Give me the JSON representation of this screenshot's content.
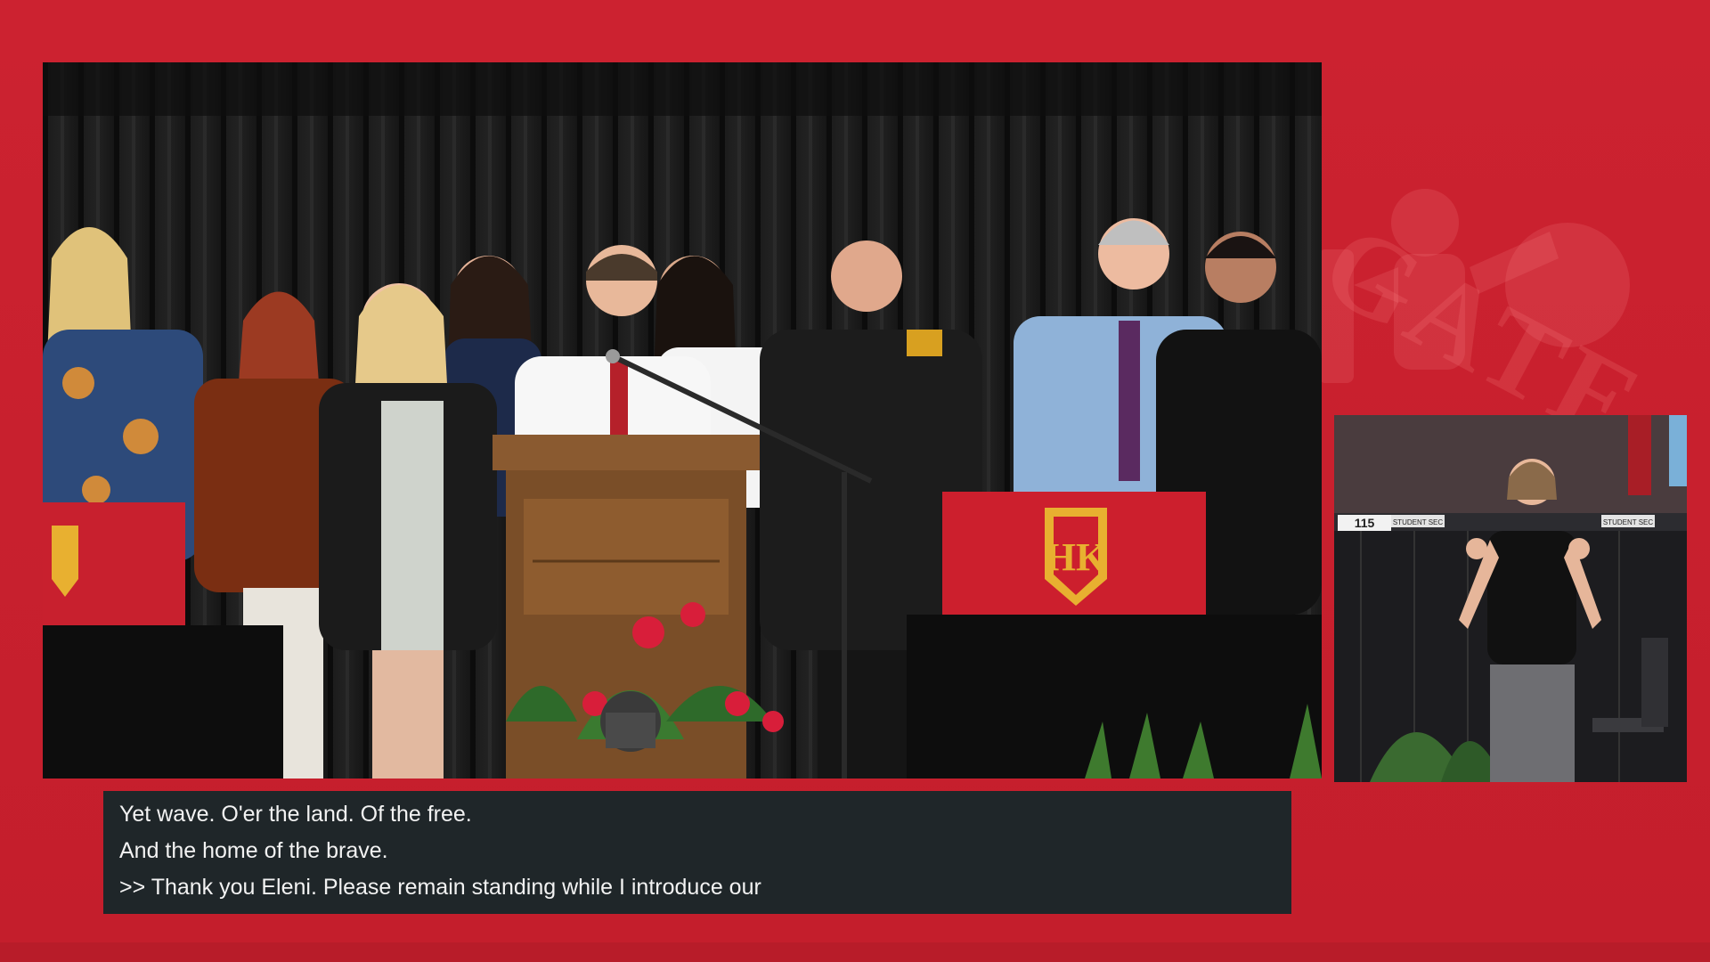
{
  "stream": {
    "brand_watermark": "HELLGATE",
    "accent_color": "#c8202e",
    "caption_bg_color": "#1f2629"
  },
  "main_video": {
    "podium_emblem": "HK",
    "banner_emblem_left": "HK",
    "banner_emblem_right": "HK"
  },
  "interpreter_video": {
    "section_sign_number": "115",
    "section_sign_left": "STUDENT SEC",
    "section_sign_right": "STUDENT SEC"
  },
  "captions": {
    "lines": [
      "Yet wave. O'er the land. Of the free.",
      "And the home of the brave.",
      ">> Thank you Eleni. Please remain standing while I introduce our"
    ]
  }
}
